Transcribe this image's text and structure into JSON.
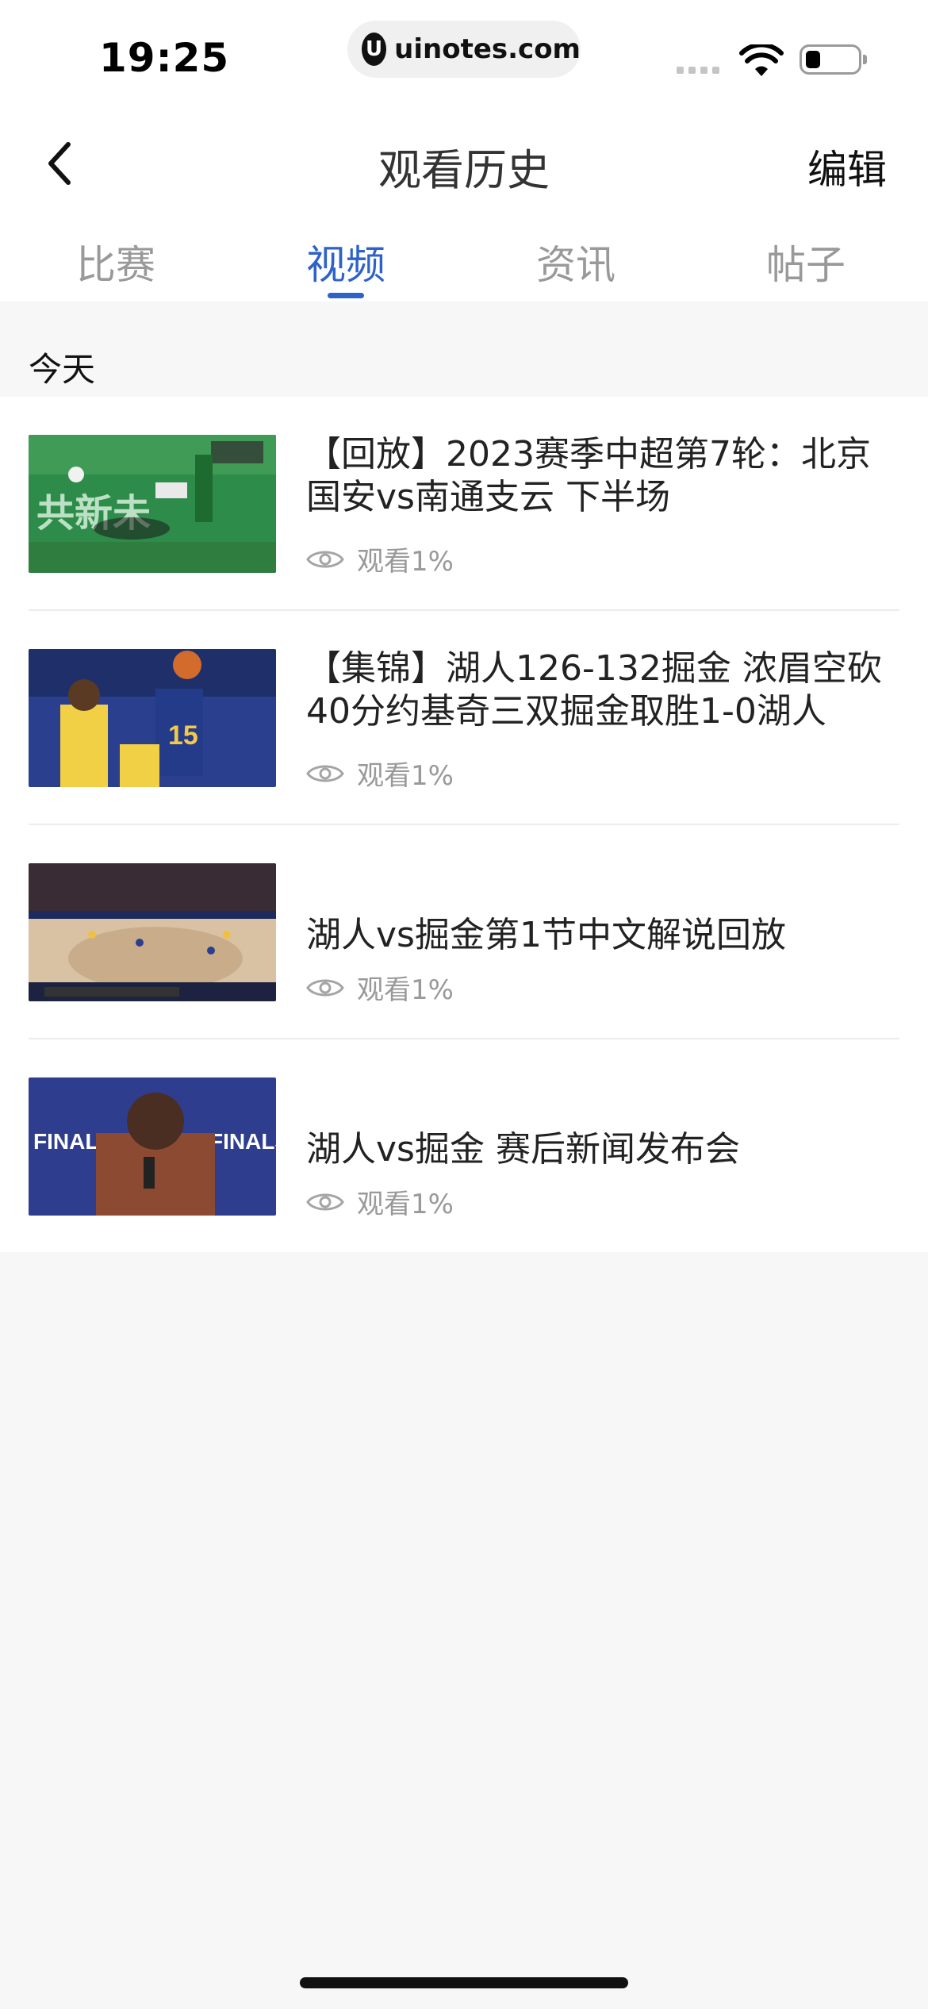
{
  "status_bar": {
    "time": "19:25",
    "url": "uinotes.com",
    "url_logo": "U"
  },
  "header": {
    "title": "观看历史",
    "edit_label": "编辑",
    "back_icon": "chevron-left-icon"
  },
  "tabs": [
    {
      "label": "比赛",
      "active": false
    },
    {
      "label": "视频",
      "active": true
    },
    {
      "label": "资讯",
      "active": false
    },
    {
      "label": "帖子",
      "active": false
    }
  ],
  "section": {
    "title": "今天"
  },
  "videos": [
    {
      "title": "【回放】2023赛季中超第7轮：北京国安vs南通支云 下半场",
      "views": "观看1%",
      "thumb_label": "共新未",
      "thumb_color": "#2d8c4a"
    },
    {
      "title": "【集锦】湖人126-132掘金 浓眉空砍40分约基奇三双掘金取胜1-0湖人",
      "views": "观看1%",
      "thumb_label": "15",
      "thumb_color": "#2b3f8f"
    },
    {
      "title": "湖人vs掘金第1节中文解说回放",
      "views": "观看1%",
      "thumb_label": "",
      "thumb_color": "#d9c2a3"
    },
    {
      "title": "湖人vs掘金 赛后新闻发布会",
      "views": "观看1%",
      "thumb_label": "FINALS",
      "thumb_color": "#2f3d8f"
    }
  ]
}
